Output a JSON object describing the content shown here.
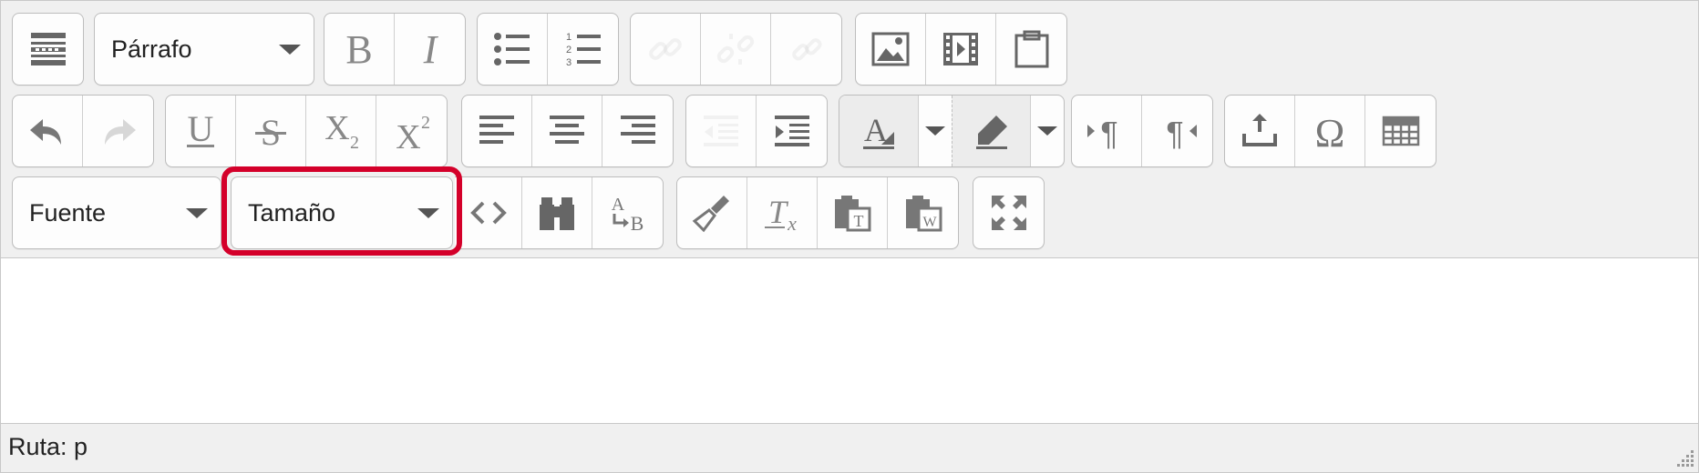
{
  "toolbar": {
    "format_value": "Párrafo",
    "font_value": "Fuente",
    "size_value": "Tamaño"
  },
  "status": {
    "path_label": "Ruta: p"
  },
  "highlight_color": "#d4002a",
  "icons": {
    "row1": [
      "toggle-toolbar-icon",
      "bold-icon",
      "italic-icon",
      "bullet-list-icon",
      "numbered-list-icon",
      "link-icon",
      "unlink-icon",
      "anchor-icon",
      "image-icon",
      "media-icon",
      "paste-icon"
    ],
    "row2": [
      "undo-icon",
      "redo-icon",
      "underline-icon",
      "strikethrough-icon",
      "subscript-icon",
      "superscript-icon",
      "align-left-icon",
      "align-center-icon",
      "align-right-icon",
      "outdent-icon",
      "indent-icon",
      "text-color-icon",
      "background-color-icon",
      "ltr-icon",
      "rtl-icon",
      "upload-icon",
      "special-char-icon",
      "table-icon"
    ],
    "row3": [
      "code-icon",
      "find-icon",
      "replace-icon",
      "clean-icon",
      "remove-format-icon",
      "paste-text-icon",
      "paste-word-icon",
      "fullscreen-icon"
    ]
  }
}
